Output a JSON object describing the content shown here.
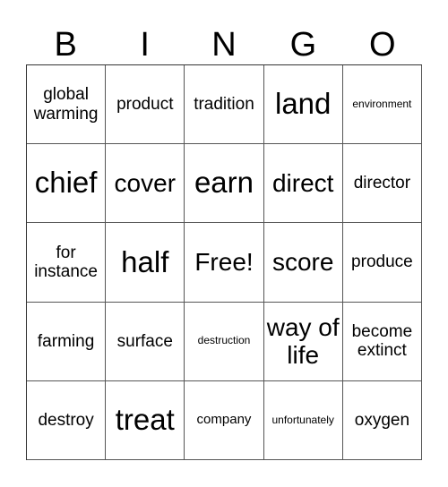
{
  "header": [
    "B",
    "I",
    "N",
    "G",
    "O"
  ],
  "cells": [
    {
      "text": "global warming",
      "size": "md"
    },
    {
      "text": "product",
      "size": "md"
    },
    {
      "text": "tradition",
      "size": "md"
    },
    {
      "text": "land",
      "size": "xxl"
    },
    {
      "text": "environment",
      "size": "xs"
    },
    {
      "text": "chief",
      "size": "xxl"
    },
    {
      "text": "cover",
      "size": "xl"
    },
    {
      "text": "earn",
      "size": "xxl"
    },
    {
      "text": "direct",
      "size": "xl"
    },
    {
      "text": "director",
      "size": "md"
    },
    {
      "text": "for instance",
      "size": "md"
    },
    {
      "text": "half",
      "size": "xxl"
    },
    {
      "text": "Free!",
      "size": "xl"
    },
    {
      "text": "score",
      "size": "xl"
    },
    {
      "text": "produce",
      "size": "md"
    },
    {
      "text": "farming",
      "size": "md"
    },
    {
      "text": "surface",
      "size": "md"
    },
    {
      "text": "destruction",
      "size": "xs"
    },
    {
      "text": "way of life",
      "size": "xl"
    },
    {
      "text": "become extinct",
      "size": "md"
    },
    {
      "text": "destroy",
      "size": "md"
    },
    {
      "text": "treat",
      "size": "xxl"
    },
    {
      "text": "company",
      "size": "sm"
    },
    {
      "text": "unfortunately",
      "size": "xs"
    },
    {
      "text": "oxygen",
      "size": "md"
    }
  ]
}
